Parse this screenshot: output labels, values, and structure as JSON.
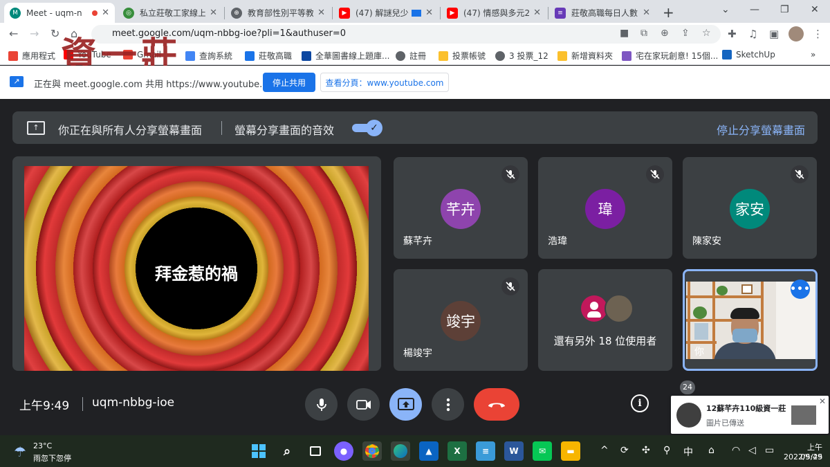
{
  "browser": {
    "tabs": [
      {
        "title": "Meet - uqm-n",
        "active": true
      },
      {
        "title": "私立莊敬工家線上",
        "active": false
      },
      {
        "title": "教育部性別平等教",
        "active": false
      },
      {
        "title": "(47) 解謎兒少",
        "active": false
      },
      {
        "title": "(47) 情感與多元202",
        "active": false
      },
      {
        "title": "莊敬高職每日人數",
        "active": false
      }
    ],
    "new_tab": "+",
    "address": "meet.google.com/uqm-nbbg-ioe?pli=1&authuser=0",
    "watermark": "資一莊"
  },
  "bookmarks": [
    {
      "label": "應用程式",
      "color": "#ea4335"
    },
    {
      "label": "YouTube",
      "color": "#ff0000"
    },
    {
      "label": "Gmail",
      "color": "#ea4335"
    },
    {
      "label": "查詢系統",
      "color": "#4285f4"
    },
    {
      "label": "莊敬高職",
      "color": "#1a73e8"
    },
    {
      "label": "全華圖書線上題庫...",
      "color": "#0d47a1"
    },
    {
      "label": "註冊",
      "color": "#5f6368"
    },
    {
      "label": "投票帳號",
      "color": "#fbc02d"
    },
    {
      "label": "3 投票_12",
      "color": "#5f6368"
    },
    {
      "label": "新增資料夾",
      "color": "#fbc02d"
    },
    {
      "label": "宅在家玩創意! 15個...",
      "color": "#7e57c2"
    },
    {
      "label": "SketchUp",
      "color": "#1565c0"
    }
  ],
  "share_bar": {
    "text": "正在與 meet.google.com 共用 https://www.youtube.com",
    "stop_label": "停止共用",
    "view_label": "查看分頁：www.youtube.com"
  },
  "meet": {
    "banner_text": "你正在與所有人分享螢幕畫面",
    "audio_label": "螢幕分享畫面的音效",
    "stop_share_label": "停止分享螢幕畫面",
    "video_title": "拜金惹的禍",
    "participants": [
      {
        "initials": "芊卉",
        "name": "蘇芊卉",
        "color": "#8e44ad"
      },
      {
        "initials": "瑋",
        "name": "浩瑋",
        "color": "#7b1fa2"
      },
      {
        "initials": "家安",
        "name": "陳家安",
        "color": "#00897b"
      },
      {
        "initials": "竣宇",
        "name": "楊竣宇",
        "color": "#5d4037"
      }
    ],
    "others_text": "還有另外 18 位使用者",
    "self_label": "你",
    "time": "上午9:49",
    "code": "uqm-nbbg-ioe",
    "people_count": "24",
    "accent": "#8ab4f8",
    "end_color": "#ea4335"
  },
  "notification": {
    "title": "12蘇芊卉110級資一莊",
    "subtitle": "圖片已傳送"
  },
  "taskbar": {
    "temp": "23°C",
    "weather": "雨忽下忽停",
    "ime": "中",
    "clock_time": "上午 09:49",
    "clock_date": "2022/5/25"
  }
}
